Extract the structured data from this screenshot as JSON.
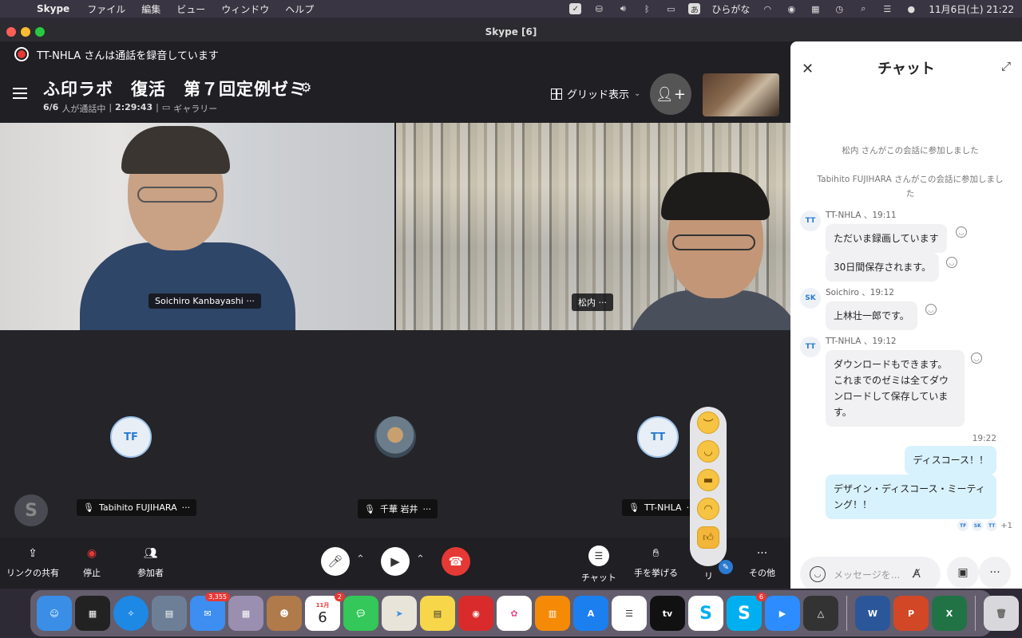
{
  "menubar": {
    "app_name": "Skype",
    "items": [
      "ファイル",
      "編集",
      "ビュー",
      "ウィンドウ",
      "ヘルプ"
    ],
    "input_method": "ひらがな",
    "input_badge": "あ",
    "datetime": "11月6日(土)  21:22"
  },
  "window": {
    "title": "Skype [6]"
  },
  "recording": {
    "text": "TT-NHLA さんは通話を録音しています"
  },
  "call": {
    "title": "ふ印ラボ　復活　第７回定例ゼミ",
    "participants": "6/6",
    "in_call_label": "人が通話中",
    "duration": "2:29:43",
    "view_label": "ギャラリー",
    "grid_label": "グリッド表示"
  },
  "participants": {
    "video1_name": "Soichiro Kanbayashi",
    "video2_name": "松内",
    "avatar1_initials": "TF",
    "avatar1_name": "Tabihito FUJIHARA",
    "avatar2_name": "千華 岩井",
    "avatar3_initials": "TT",
    "avatar3_name": "TT-NHLA",
    "more": "···"
  },
  "toolbar": {
    "share_link": "リンクの共有",
    "stop": "停止",
    "participants": "参加者",
    "chat": "チャット",
    "raise_hand": "手を挙げる",
    "reactions": "リ",
    "more": "その他"
  },
  "chat": {
    "title": "チャット",
    "sys1": "松内 さんがこの会話に参加しました",
    "sys2": "Tabihito FUJIHARA さんがこの会話に参加しました",
    "msg1_sender": "TT-NHLA 、19:11",
    "msg1_avatar": "TT",
    "msg1_a": "ただいま録画しています",
    "msg1_b": "30日間保存されます。",
    "msg2_sender": "Soichiro 、19:12",
    "msg2_avatar": "SK",
    "msg2_a": "上林壮一郎です。",
    "msg3_sender": "TT-NHLA 、19:12",
    "msg3_avatar": "TT",
    "msg3_a": "ダウンロードもできます。これまでのゼミは全てダウンロードして保存しています。",
    "mine_time": "19:22",
    "mine1": "ディスコース！！",
    "mine2": "デザイン・ディスコース・ミーティング！！",
    "readers": [
      "TF",
      "SK",
      "TT"
    ],
    "readers_more": "+1",
    "composer_placeholder": "メッセージを..."
  },
  "dock": {
    "mail_badge": "3,355",
    "calendar_month": "11月",
    "calendar_day": "6",
    "calendar_badge": "2",
    "skype2_badge": "6",
    "tv_label": "tv"
  }
}
